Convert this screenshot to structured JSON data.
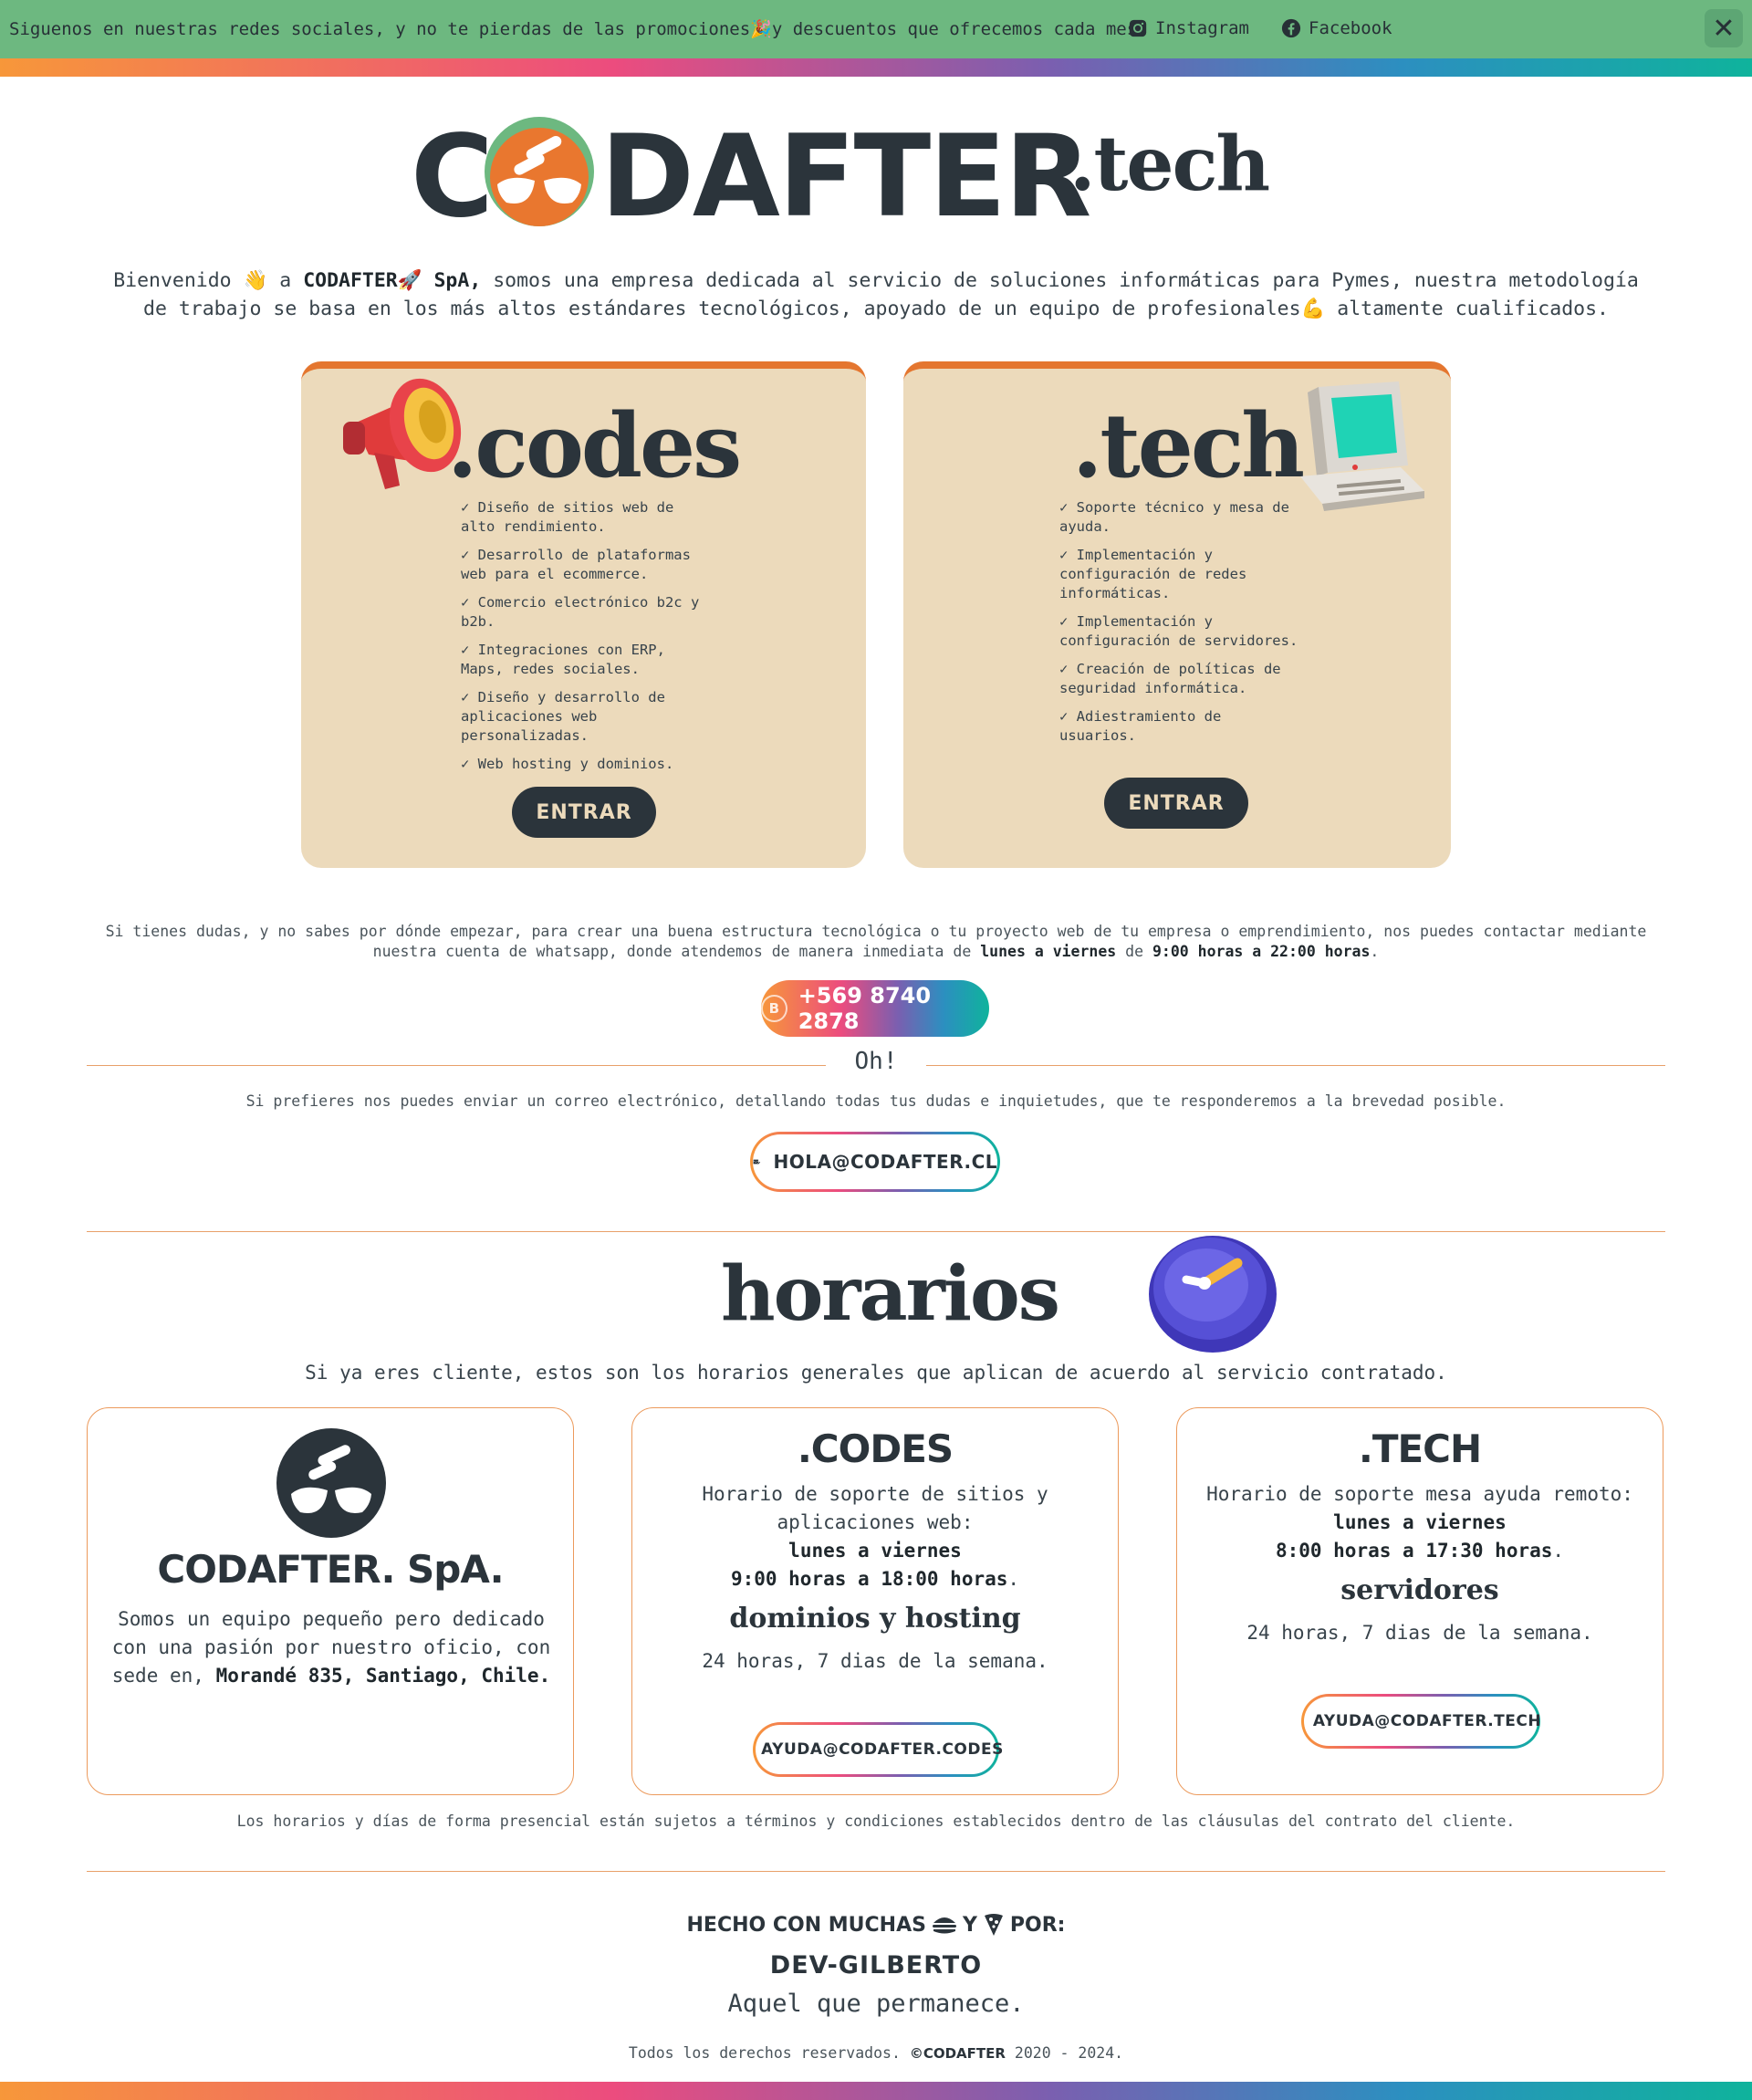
{
  "banner": {
    "text": "Siguenos en nuestras redes sociales, y no te pierdas de las promociones🎉y descuentos que ofrecemos cada mes:",
    "instagram": "Instagram",
    "facebook": "Facebook",
    "close": "✕"
  },
  "colors": {
    "banner_bg": "#6db880",
    "accent_orange": "#e4762f",
    "card_bg": "#ecdabb",
    "dark": "#2b343b",
    "teal": "#0fb39c",
    "pink": "#ec4c7e"
  },
  "logo": {
    "text_left": "C",
    "text_right": "DAFTER",
    "suffix": ".tech"
  },
  "intro": {
    "p1": "Bienvenido ",
    "wave": "👋",
    "p2": " a ",
    "brand": "CODAFTER",
    "rocket": "🚀",
    "brand2": " SpA,",
    "p3": " somos una empresa dedicada al servicio de soluciones informáticas para Pymes, nuestra metodología de trabajo se basa en los más altos estándares tecnológicos, apoyado de un equipo de profesionales",
    "muscle": "💪",
    "p4": " altamente cualificados."
  },
  "cards": {
    "codes": {
      "title": ".codes",
      "items": [
        "✓ Diseño de sitios web de alto rendimiento.",
        "✓ Desarrollo de plataformas web para el ecommerce.",
        "✓ Comercio electrónico b2c y b2b.",
        "✓ Integraciones con ERP, Maps, redes sociales.",
        "✓ Diseño y desarrollo de aplicaciones web personalizadas.",
        "✓ Web hosting y dominios."
      ],
      "button": "ENTRAR"
    },
    "tech": {
      "title": ".tech",
      "items": [
        "✓ Soporte técnico y mesa de ayuda.",
        "✓ Implementación y configuración de redes informáticas.",
        "✓ Implementación y configuración de servidores.",
        "✓ Creación de políticas de seguridad informática.",
        "✓ Adiestramiento de usuarios."
      ],
      "button": "ENTRAR"
    }
  },
  "contact": {
    "p1": "Si tienes dudas, y no sabes por dónde empezar, para crear una buena estructura tecnológica o tu proyecto web de tu empresa o emprendimiento, nos puedes contactar mediante nuestra cuenta de whatsapp, donde atendemos de manera inmediata de ",
    "days": "lunes a viernes",
    "p2": " de ",
    "hours": "9:00 horas a 22:00 horas",
    "p3": ".",
    "phone": "+569 8740 2878",
    "oh": "Oh!",
    "email_text": "Si prefieres nos puedes enviar un correo electrónico, detallando todas tus dudas e inquietudes, que te responderemos a la brevedad posible.",
    "email": "HOLA@CODAFTER.CL"
  },
  "horarios": {
    "title": "horarios",
    "subtitle": "Si ya eres cliente, estos son los horarios generales que aplican de acuerdo al servicio contratado.",
    "company": {
      "name": "CODAFTER. SpA.",
      "text": "Somos un equipo pequeño pero dedicado con una pasión por nuestro oficio, con sede en, ",
      "address": "Morandé 835, Santiago, Chile."
    },
    "codes": {
      "title": ".CODES",
      "text": "Horario de soporte de sitios y aplicaciones web:",
      "days": "lunes a viernes",
      "hours": "9:00 horas a 18:00 horas",
      "subtitle": "dominios y hosting",
      "always": "24 horas, 7 dias de la semana.",
      "email": "AYUDA@CODAFTER.CODES"
    },
    "tech": {
      "title": ".TECH",
      "text": "Horario de soporte mesa ayuda remoto:",
      "days": "lunes a viernes",
      "hours": "8:00 horas a 17:30 horas",
      "subtitle": "servidores",
      "always": "24 horas, 7 dias de la semana.",
      "email": "AYUDA@CODAFTER.TECH"
    },
    "footnote": "Los horarios y días de forma presencial están sujetos a términos y condiciones establecidos dentro de las cláusulas del contrato del cliente."
  },
  "footer": {
    "made_pre": "HECHO CON MUCHAS",
    "made_mid": "Y",
    "made_post": "POR:",
    "dev": "DEV-GILBERTO",
    "motto": "Aquel que permanece.",
    "rights": "Todos los derechos reservados. ",
    "brand": "©CODAFTER",
    "years": " 2020 - 2024."
  }
}
